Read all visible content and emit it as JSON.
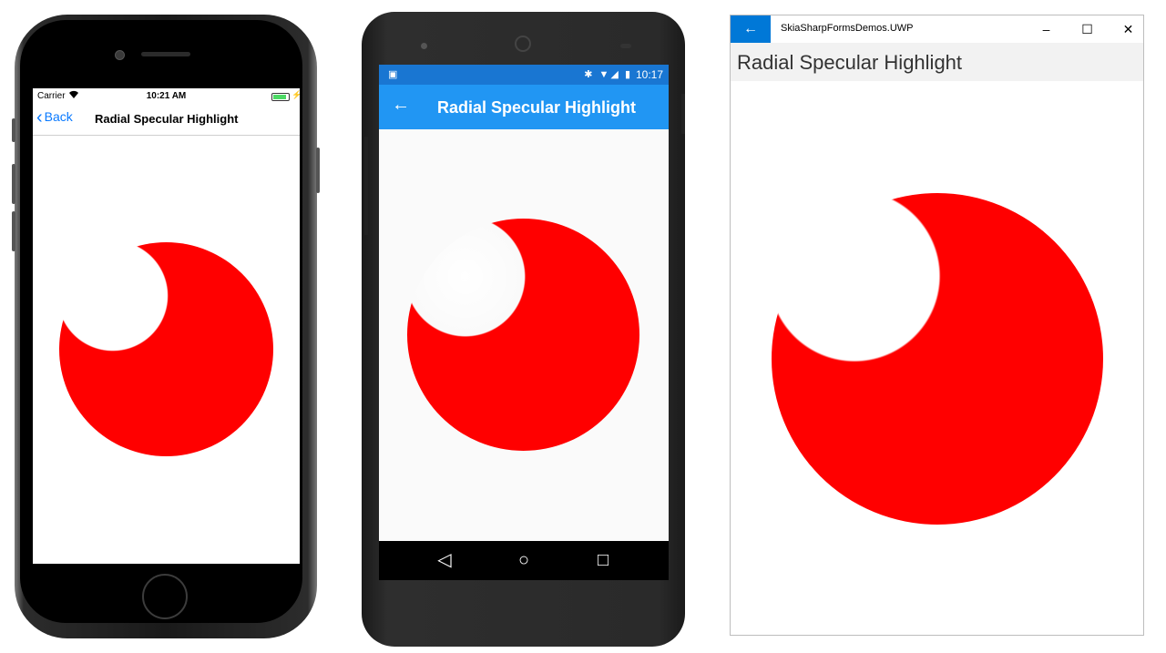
{
  "ios": {
    "carrier": "Carrier",
    "wifi_icon": "wifi-icon",
    "time": "10:21 AM",
    "battery_level": 0.9,
    "back_label": "Back",
    "title": "Radial Specular Highlight",
    "accent": "#0a7aff"
  },
  "android": {
    "time": "10:17",
    "status_icons": "✱ ▼◢ ▮",
    "title": "Radial Specular Highlight",
    "back_glyph": "←",
    "nav_back": "◁",
    "nav_home": "○",
    "nav_recent": "□",
    "status_bar_color": "#1976d2",
    "app_bar_color": "#2196f3"
  },
  "uwp": {
    "app_name": "SkiaSharpFormsDemos.UWP",
    "title": "Radial Specular Highlight",
    "back_glyph": "←",
    "minimize_glyph": "–",
    "maximize_glyph": "☐",
    "close_glyph": "✕",
    "accent": "#0078d7"
  },
  "sphere": {
    "color": "#ff0000",
    "highlight_color": "#ffffff"
  }
}
